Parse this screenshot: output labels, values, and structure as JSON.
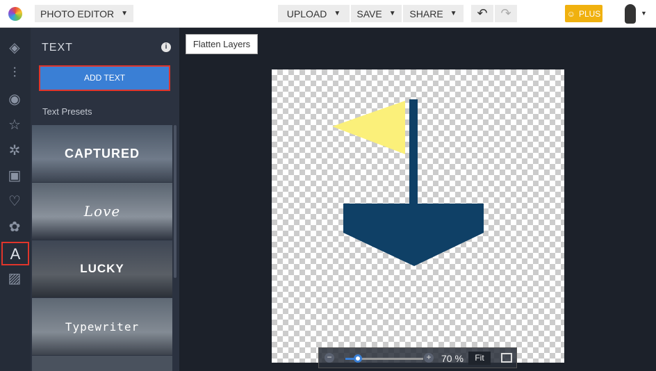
{
  "header": {
    "app_menu": "PHOTO EDITOR",
    "upload": "UPLOAD",
    "save": "SAVE",
    "share": "SHARE",
    "plus": "PLUS"
  },
  "panel": {
    "title": "TEXT",
    "add_text": "ADD TEXT",
    "presets_label": "Text Presets",
    "presets": [
      {
        "label": "CAPTURED"
      },
      {
        "label": "Love"
      },
      {
        "label": "LUCKY"
      },
      {
        "label": "Typewriter"
      }
    ]
  },
  "canvas": {
    "flatten": "Flatten Layers",
    "zoom_percent": "70 %",
    "zoom_value": 70,
    "fit": "Fit",
    "ship_color": "#0f4066",
    "flag_color": "#fbf07a"
  },
  "colors": {
    "accent": "#3a7fd5",
    "plus": "#f0b10f",
    "highlight": "#e0352b"
  }
}
